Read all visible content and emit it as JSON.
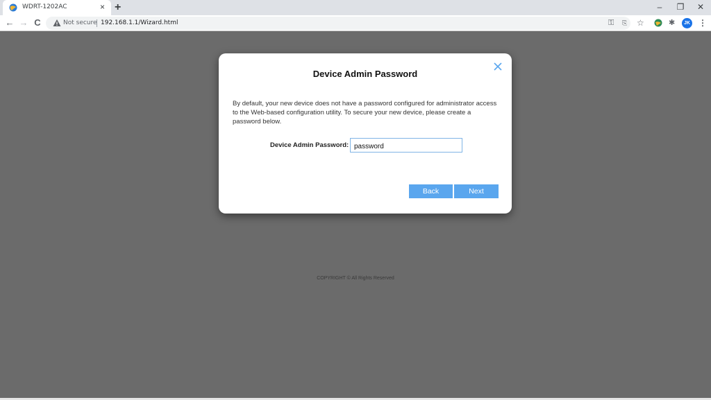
{
  "browser": {
    "tab_title": "WDRT-1202AC",
    "tab_close": "×",
    "new_tab": "+",
    "window_controls": {
      "minimize": "–",
      "restore": "❐",
      "close": "✕"
    },
    "nav": {
      "back": "←",
      "forward": "→",
      "reload": "C"
    },
    "security_label": "Not secure",
    "url": "192.168.1.1/Wizard.html",
    "omnibox_icons": [
      "key-icon",
      "translate-icon",
      "star-icon"
    ],
    "extension_icons": [
      "extension-globe-icon",
      "puzzle-icon"
    ],
    "profile_initials": "JK",
    "menu": "⋮"
  },
  "dialog": {
    "title": "Device Admin Password",
    "close": "×",
    "description": "By default, your new device does not have a password configured for administrator access to the Web-based configuration utility. To secure your new device, please create a password below.",
    "password_label": "Device Admin Password:",
    "password_value": "password",
    "back_label": "Back",
    "next_label": "Next"
  },
  "footer": {
    "copyright": "COPYRIGHT © All Rights Reserved"
  },
  "colors": {
    "page_background": "#6b6b6b",
    "button": "#5aa6ee",
    "input_border": "#7fb4e6",
    "close_icon": "#5aa6ee"
  }
}
